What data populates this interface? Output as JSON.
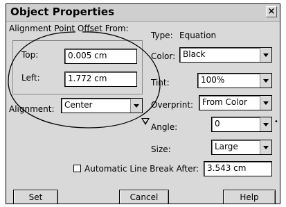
{
  "window": {
    "title": "Object Properties",
    "close_glyph": "×"
  },
  "alignment_point": {
    "heading": "Alignment Point Offset From:",
    "top_label": "Top:",
    "top_value": "0.005 cm",
    "left_label": "Left:",
    "left_value": "1.772 cm"
  },
  "alignment": {
    "label": "Alignment:",
    "value": "Center"
  },
  "type": {
    "label": "Type:",
    "value": "Equation"
  },
  "color": {
    "label": "Color:",
    "value": "Black"
  },
  "tint": {
    "label": "Tint:",
    "value": "100%"
  },
  "overprint": {
    "label": "Overprint:",
    "value": "From Color"
  },
  "angle": {
    "label": "Angle:",
    "value": "0",
    "degree_mark": "•"
  },
  "size": {
    "label": "Size:",
    "value": "Large"
  },
  "line_break": {
    "label": "Automatic Line Break After:",
    "checked": false,
    "value": "3.543 cm"
  },
  "buttons": {
    "set": "Set",
    "cancel": "Cancel",
    "help": "Help"
  },
  "annotation": {
    "shape": "hand-drawn ellipse",
    "color": "#000000"
  }
}
